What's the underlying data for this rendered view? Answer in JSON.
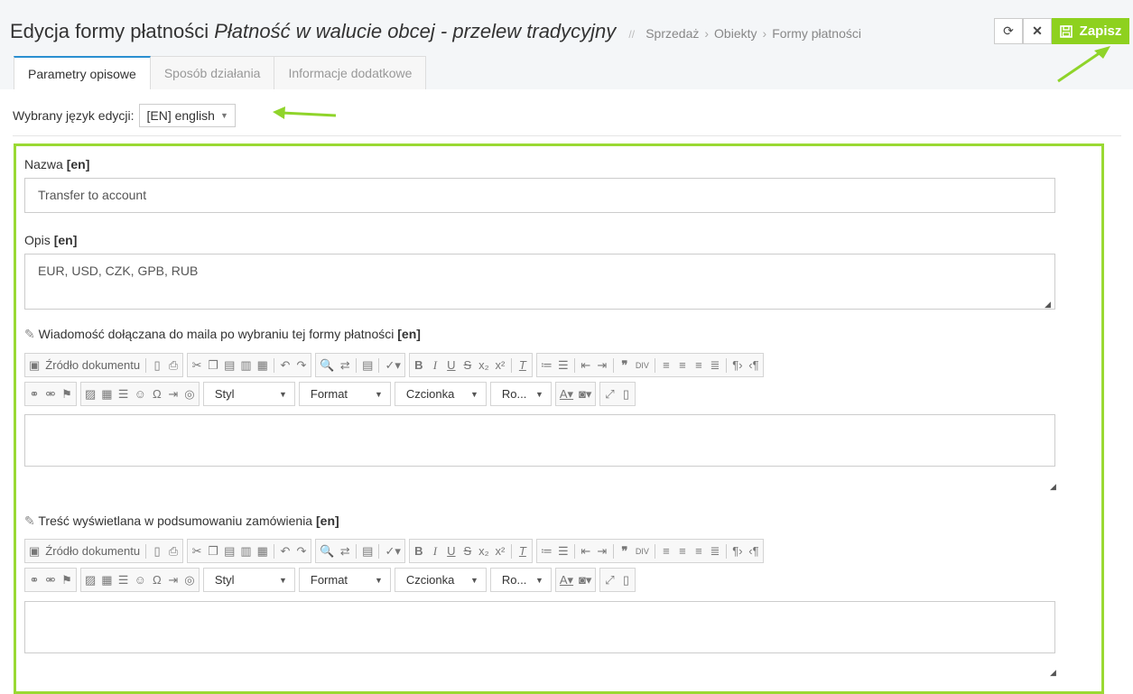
{
  "header": {
    "title_main": "Edycja formy płatności",
    "title_italic": "Płatność w walucie obcej - przelew tradycyjny",
    "separator": "//",
    "breadcrumb": [
      "Sprzedaż",
      "Obiekty",
      "Formy płatności"
    ],
    "refresh_icon": "refresh-icon",
    "close_icon": "close-icon",
    "save_label": "Zapisz",
    "save_color": "#8ed11f"
  },
  "tabs": [
    {
      "label": "Parametry opisowe",
      "active": true
    },
    {
      "label": "Sposób działania",
      "active": false
    },
    {
      "label": "Informacje dodatkowe",
      "active": false
    }
  ],
  "language": {
    "label": "Wybrany język edycji:",
    "value": "[EN] english"
  },
  "form": {
    "name_label": "Nazwa",
    "name_tag": "[en]",
    "name_value": "Transfer to account",
    "desc_label": "Opis",
    "desc_tag": "[en]",
    "desc_value": "EUR, USD, CZK, GPB, RUB",
    "mail_label": "Wiadomość dołączana do maila po wybraniu tej formy płatności",
    "mail_tag": "[en]",
    "summary_label": "Treść wyświetlana w podsumowaniu zamówienia",
    "summary_tag": "[en]"
  },
  "editor_toolbar": {
    "source_label": "Źródło dokumentu",
    "style_label": "Styl",
    "format_label": "Format",
    "font_label": "Czcionka",
    "size_label": "Ro..."
  },
  "accent_color": "#9ad933"
}
